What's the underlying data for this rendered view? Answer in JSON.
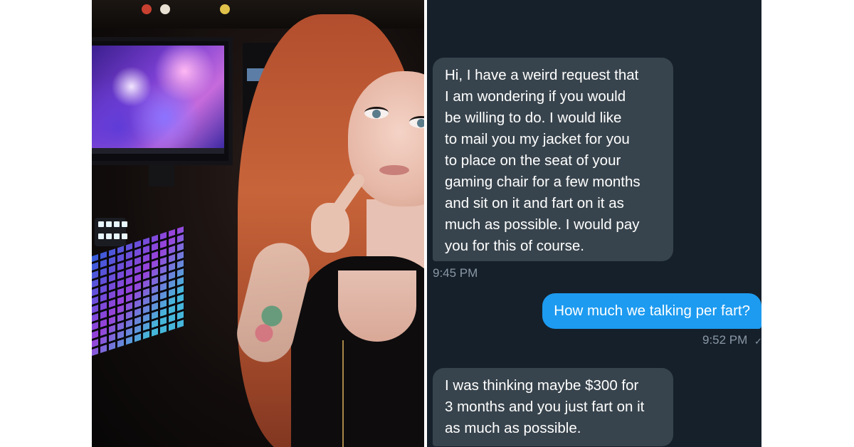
{
  "messages": [
    {
      "direction": "incoming",
      "text": "Hi, I have a weird request that\nI am wondering if you would\nbe willing to do. I would like\nto mail you my jacket for you\nto place on the seat of your\ngaming chair for a few months\nand sit on it and fart on it as\nmuch as possible. I would pay\nyou for this of course.",
      "time": "9:45 PM"
    },
    {
      "direction": "outgoing",
      "text": "How much we talking per fart?",
      "time": "9:52 PM",
      "read_mark": "✓"
    },
    {
      "direction": "incoming",
      "text": "I was thinking maybe $300 for\n3 months and you just fart on it\nas much as possible."
    }
  ],
  "colors": {
    "chat_background": "#15202b",
    "incoming_bubble": "#38444d",
    "outgoing_bubble": "#1d9bf0",
    "timestamp": "#8b98a5"
  }
}
